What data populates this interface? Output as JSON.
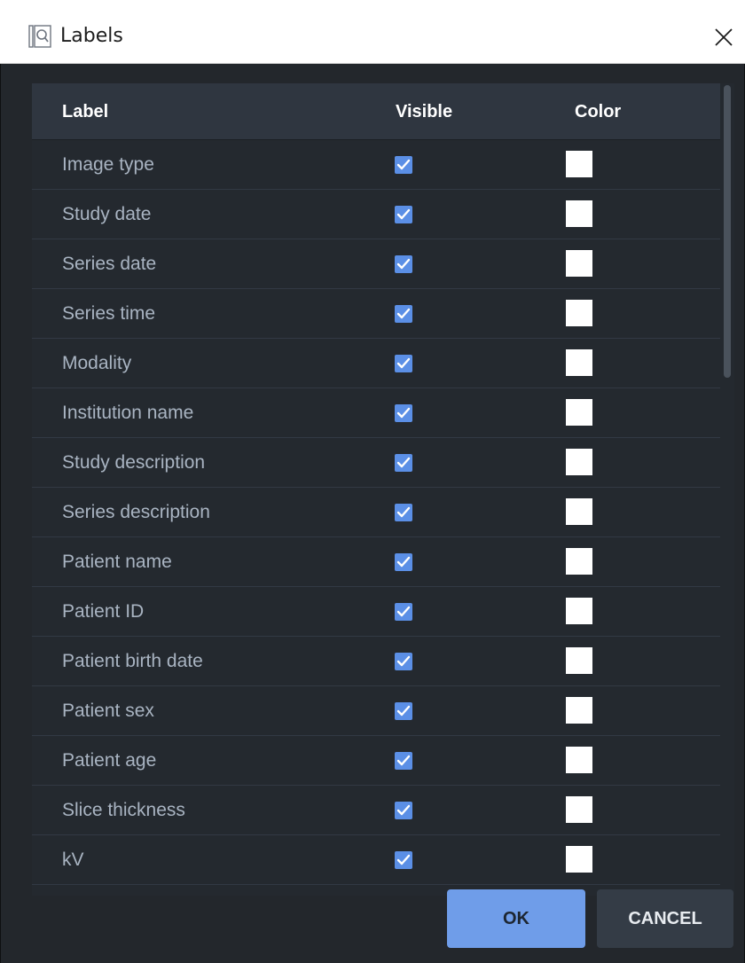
{
  "window": {
    "title": "Labels",
    "icon": "dicom-viewer-icon",
    "close_icon": "close-icon"
  },
  "table": {
    "columns": [
      "Label",
      "Visible",
      "Color"
    ],
    "rows": [
      {
        "label": "Image type",
        "visible": true,
        "color": "#ffffff"
      },
      {
        "label": "Study date",
        "visible": true,
        "color": "#ffffff"
      },
      {
        "label": "Series date",
        "visible": true,
        "color": "#ffffff"
      },
      {
        "label": "Series time",
        "visible": true,
        "color": "#ffffff"
      },
      {
        "label": "Modality",
        "visible": true,
        "color": "#ffffff"
      },
      {
        "label": "Institution name",
        "visible": true,
        "color": "#ffffff"
      },
      {
        "label": "Study description",
        "visible": true,
        "color": "#ffffff"
      },
      {
        "label": "Series description",
        "visible": true,
        "color": "#ffffff"
      },
      {
        "label": "Patient name",
        "visible": true,
        "color": "#ffffff"
      },
      {
        "label": "Patient ID",
        "visible": true,
        "color": "#ffffff"
      },
      {
        "label": "Patient birth date",
        "visible": true,
        "color": "#ffffff"
      },
      {
        "label": "Patient sex",
        "visible": true,
        "color": "#ffffff"
      },
      {
        "label": "Patient age",
        "visible": true,
        "color": "#ffffff"
      },
      {
        "label": "Slice thickness",
        "visible": true,
        "color": "#ffffff"
      },
      {
        "label": "kV",
        "visible": true,
        "color": "#ffffff"
      }
    ]
  },
  "buttons": {
    "ok": "OK",
    "cancel": "CANCEL"
  },
  "colors": {
    "accent": "#6f9de9",
    "checkbox": "#5b8fe6",
    "background": "#23272c",
    "header": "#2f3640"
  }
}
